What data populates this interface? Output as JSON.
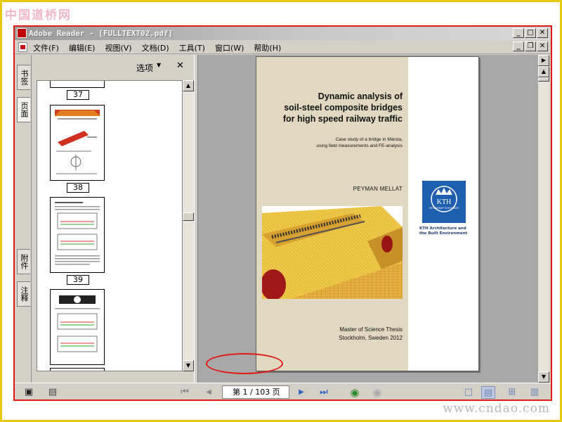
{
  "site": {
    "logo_text": "中国道桥网",
    "watermark": "www.cndao.com"
  },
  "window": {
    "title": "Adobe Reader - [FULLTEXT02.pdf]",
    "controls": {
      "minimize": "_",
      "maximize": "□",
      "close": "✕",
      "restore": "❐"
    }
  },
  "menu": {
    "items": [
      "文件(F)",
      "编辑(E)",
      "视图(V)",
      "文档(D)",
      "工具(T)",
      "窗口(W)",
      "帮助(H)"
    ]
  },
  "nav_tabs": {
    "bookmarks": "书签",
    "pages": "页面",
    "attachments": "附件",
    "comments": "注释"
  },
  "pages_panel": {
    "options_label": "选项",
    "close_glyph": "✕",
    "thumbnails": [
      {
        "page_label": "37"
      },
      {
        "page_label": "38"
      },
      {
        "page_label": "39"
      }
    ]
  },
  "document": {
    "title_lines": [
      "Dynamic analysis of",
      "soil-steel composite bridges",
      "for high speed railway traffic"
    ],
    "subtitle_lines": [
      "Case study of a bridge in Märsta,",
      "using field measurements and FE-analysis"
    ],
    "author": "PEYMAN MELLAT",
    "logo_text": "KTH",
    "logo_motto": "VETENSKAP OCH KONST",
    "logo_caption_lines": [
      "KTH Architecture and",
      "the Built Environment"
    ],
    "footer_lines": [
      "Master of Science Thesis",
      "Stockholm, Sweden 2012"
    ]
  },
  "navigation": {
    "page_indicator": "第 1 / 103 页",
    "first_glyph": "⏮",
    "prev_glyph": "◀",
    "next_glyph": "▶",
    "last_glyph": "⏭"
  },
  "colors": {
    "frame_border": "#e8c800",
    "app_outline": "#e01818",
    "cover_tan": "#e0d8c0",
    "kth_blue": "#1f5fb0",
    "nav_green": "#2a8a2a"
  }
}
